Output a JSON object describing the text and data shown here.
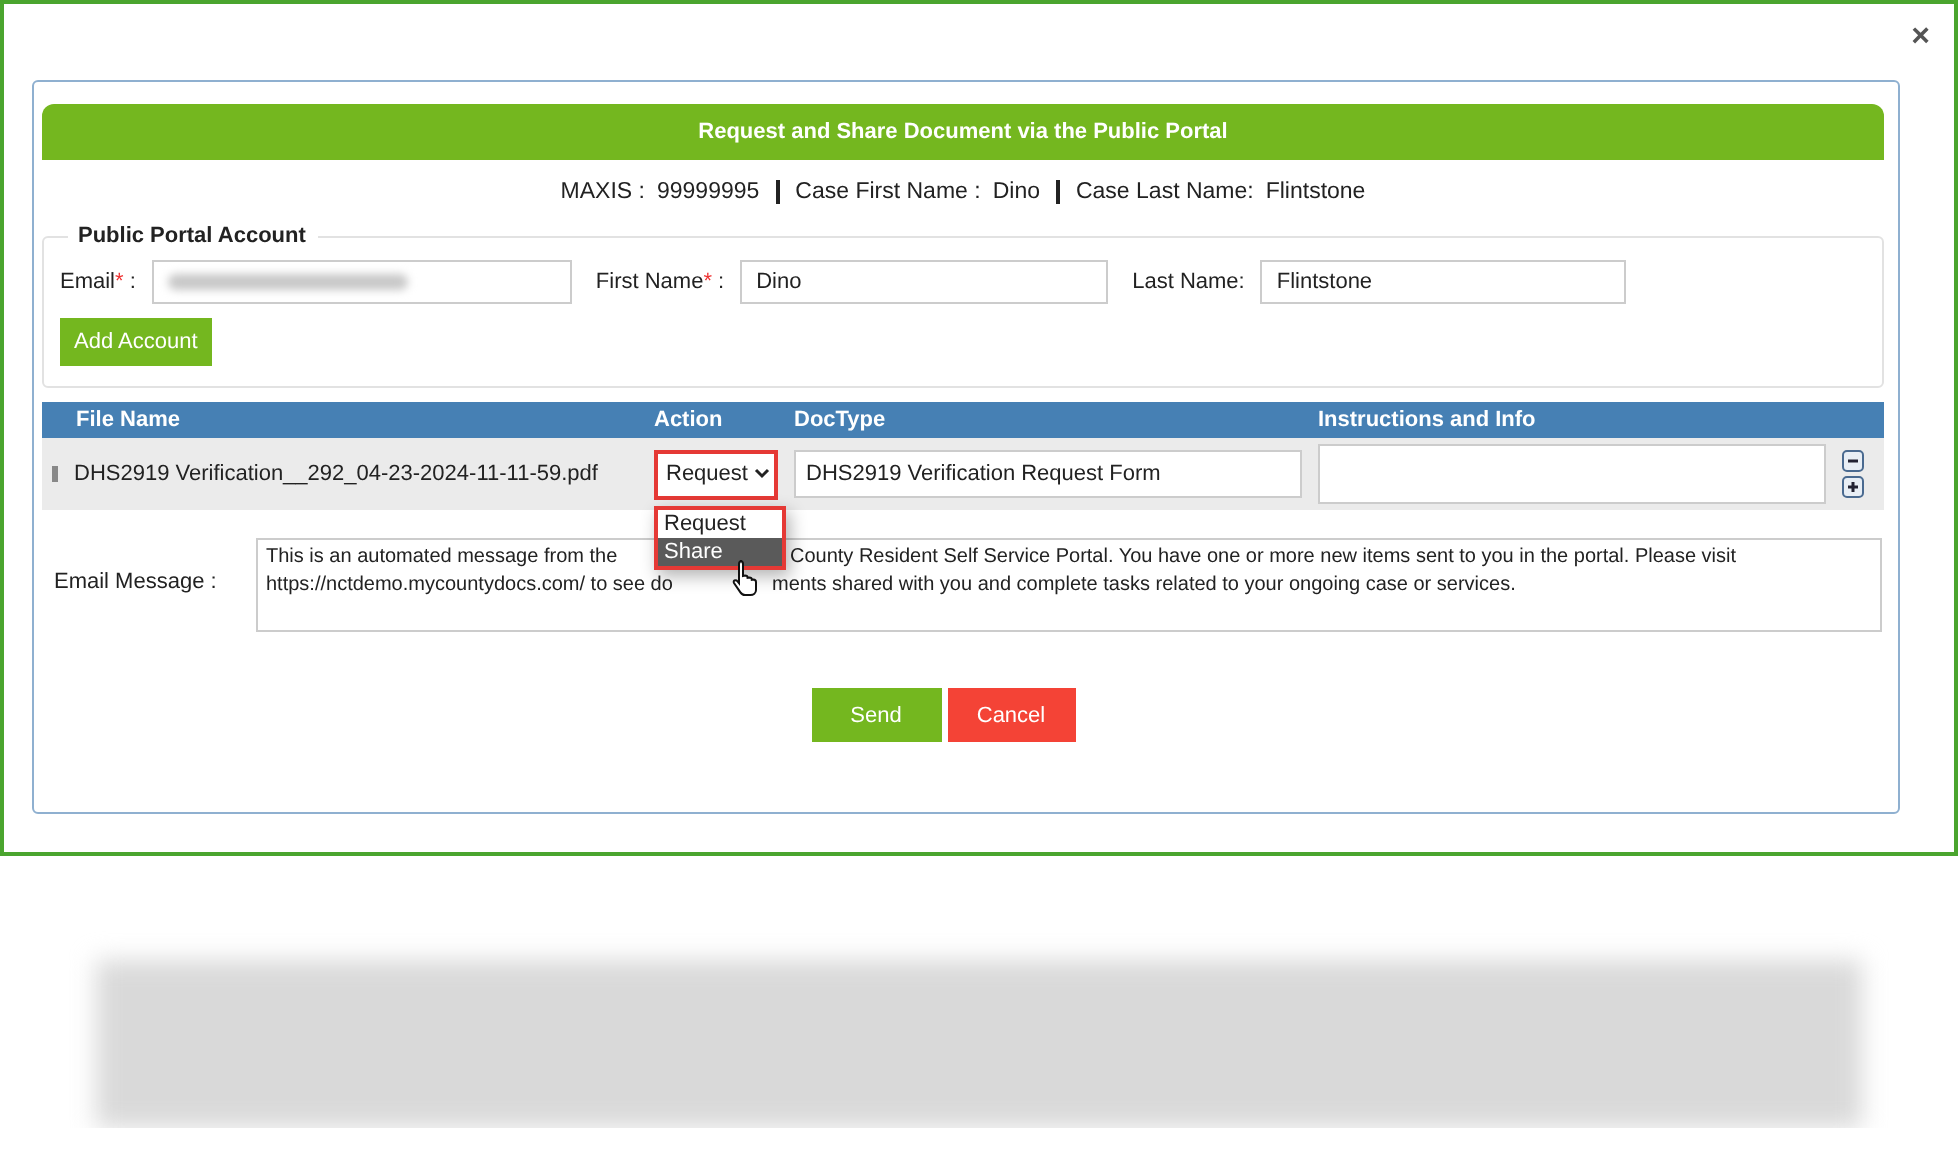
{
  "close": "×",
  "title": "Request and Share Document via the Public Portal",
  "case_info": [
    {
      "label": "MAXIS :",
      "value": "99999995"
    },
    {
      "label": "Case First Name :",
      "value": "Dino"
    },
    {
      "label": "Case Last Name:",
      "value": "Flintstone"
    }
  ],
  "account": {
    "legend": "Public Portal Account",
    "fields": [
      {
        "label": "Email",
        "required_mark": "*",
        "suffix": ":",
        "blurred": true
      },
      {
        "label": "First Name",
        "required_mark": "*",
        "suffix": ":",
        "blurred": false,
        "value": "Dino"
      },
      {
        "label": "Last Name:",
        "blurred": false,
        "value": "Flintstone"
      }
    ],
    "button": "Add Account"
  },
  "table": {
    "columns": [
      "File Name",
      "Action",
      "DocType",
      "Instructions and Info"
    ],
    "rows": [
      {
        "file": "DHS2919 Verification__292_04-23-2024-11-11-59.pdf",
        "action": "Request",
        "action_open": true,
        "action_options": [
          {
            "label": "Request",
            "selected": false
          },
          {
            "label": "Share",
            "selected": true
          }
        ],
        "doctype": "DHS2919 Verification Request Form"
      }
    ]
  },
  "email_message": {
    "label": "Email Message :",
    "lines": [
      [
        "This is an automated message from the",
        "County Resident Self Service Portal. You have one or more new items sent to you in the portal. Please visit"
      ],
      [
        "https://nctdemo.mycountydocs.com/ to see do",
        "ments shared with you and complete tasks related to your ongoing case or services."
      ]
    ]
  },
  "buttons": [
    {
      "label": "Send",
      "kind": "primary"
    },
    {
      "label": "Cancel",
      "kind": "danger"
    }
  ],
  "blurred_area": true
}
